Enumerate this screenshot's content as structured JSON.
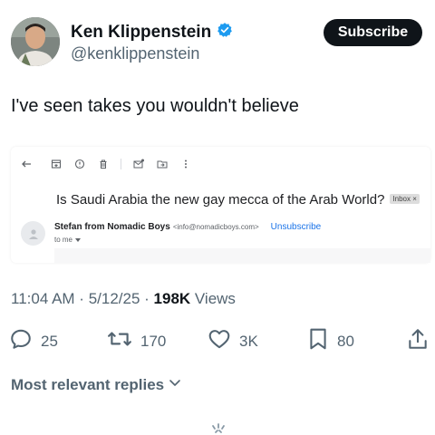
{
  "author": {
    "display_name": "Ken Klippenstein",
    "handle": "@kenklippenstein",
    "verified": true
  },
  "subscribe_label": "Subscribe",
  "tweet_text": "I've seen takes you wouldn't believe",
  "email": {
    "subject": "Is Saudi Arabia the new gay mecca of the Arab World?",
    "badge": "Inbox ×",
    "sender_name": "Stefan from Nomadic Boys",
    "sender_email": "<info@nomadicboys.com>",
    "unsubscribe": "Unsubscribe",
    "to": "to me"
  },
  "meta": {
    "time": "11:04 AM",
    "sep1": " · ",
    "date": "5/12/25",
    "sep2": " · ",
    "views_count": "198K",
    "views_label": " Views"
  },
  "actions": {
    "replies": "25",
    "reposts": "170",
    "likes": "3K",
    "bookmarks": "80"
  },
  "replies_sort": "Most relevant replies",
  "colors": {
    "text": "#0f1419",
    "secondary": "#536471",
    "verified": "#1d9bf0",
    "link": "#1a73e8"
  }
}
